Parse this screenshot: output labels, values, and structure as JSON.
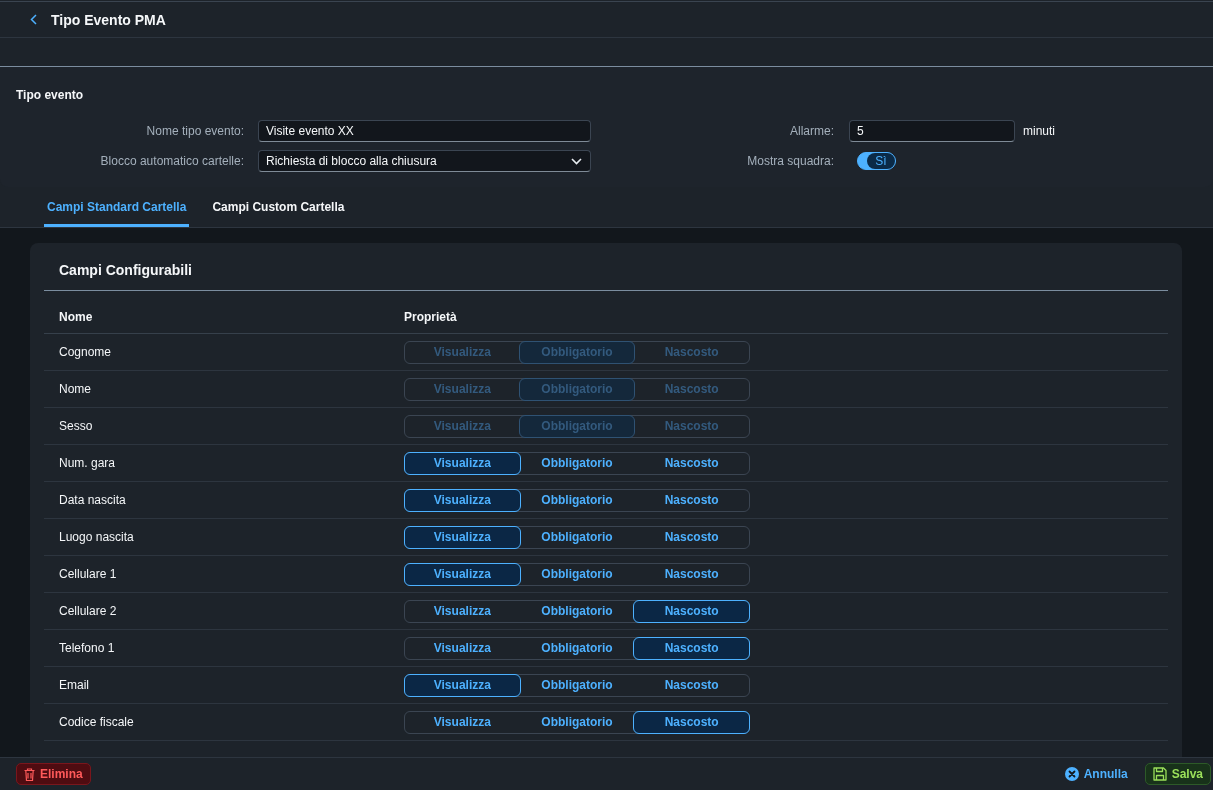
{
  "header": {
    "title": "Tipo Evento PMA"
  },
  "form": {
    "title": "Tipo evento",
    "columns": [
      [
        {
          "kind": "text",
          "label": "Nome tipo evento:",
          "value": "Visite evento XX"
        },
        {
          "kind": "select",
          "label": "Blocco automatico cartelle:",
          "value": "Richiesta di blocco alla chiusura"
        }
      ],
      [
        {
          "kind": "text",
          "label": "Allarme:",
          "value": "5",
          "unit": "minuti"
        },
        {
          "kind": "toggle",
          "label": "Mostra squadra:",
          "value": "Sì",
          "on": true
        }
      ]
    ]
  },
  "tabs": [
    {
      "label": "Campi Standard Cartella",
      "selected": true
    },
    {
      "label": "Campi Custom Cartella",
      "selected": false
    }
  ],
  "table": {
    "title": "Campi Configurabili",
    "columns": [
      "Nome",
      "Proprietà"
    ],
    "rows": [
      {
        "name": "Cognome",
        "disabled": true,
        "options": [
          {
            "label": "Visualizza",
            "selected": false
          },
          {
            "label": "Obbligatorio",
            "selected": true
          },
          {
            "label": "Nascosto",
            "selected": false
          }
        ]
      },
      {
        "name": "Nome",
        "disabled": true,
        "options": [
          {
            "label": "Visualizza",
            "selected": false
          },
          {
            "label": "Obbligatorio",
            "selected": true
          },
          {
            "label": "Nascosto",
            "selected": false
          }
        ]
      },
      {
        "name": "Sesso",
        "disabled": true,
        "options": [
          {
            "label": "Visualizza",
            "selected": false
          },
          {
            "label": "Obbligatorio",
            "selected": true
          },
          {
            "label": "Nascosto",
            "selected": false
          }
        ]
      },
      {
        "name": "Num. gara",
        "disabled": false,
        "options": [
          {
            "label": "Visualizza",
            "selected": true
          },
          {
            "label": "Obbligatorio",
            "selected": false
          },
          {
            "label": "Nascosto",
            "selected": false
          }
        ]
      },
      {
        "name": "Data nascita",
        "disabled": false,
        "options": [
          {
            "label": "Visualizza",
            "selected": true
          },
          {
            "label": "Obbligatorio",
            "selected": false
          },
          {
            "label": "Nascosto",
            "selected": false
          }
        ]
      },
      {
        "name": "Luogo nascita",
        "disabled": false,
        "options": [
          {
            "label": "Visualizza",
            "selected": true
          },
          {
            "label": "Obbligatorio",
            "selected": false
          },
          {
            "label": "Nascosto",
            "selected": false
          }
        ]
      },
      {
        "name": "Cellulare 1",
        "disabled": false,
        "options": [
          {
            "label": "Visualizza",
            "selected": true
          },
          {
            "label": "Obbligatorio",
            "selected": false
          },
          {
            "label": "Nascosto",
            "selected": false
          }
        ]
      },
      {
        "name": "Cellulare 2",
        "disabled": false,
        "options": [
          {
            "label": "Visualizza",
            "selected": false
          },
          {
            "label": "Obbligatorio",
            "selected": false
          },
          {
            "label": "Nascosto",
            "selected": true
          }
        ]
      },
      {
        "name": "Telefono 1",
        "disabled": false,
        "options": [
          {
            "label": "Visualizza",
            "selected": false
          },
          {
            "label": "Obbligatorio",
            "selected": false
          },
          {
            "label": "Nascosto",
            "selected": true
          }
        ]
      },
      {
        "name": "Email",
        "disabled": false,
        "options": [
          {
            "label": "Visualizza",
            "selected": true
          },
          {
            "label": "Obbligatorio",
            "selected": false
          },
          {
            "label": "Nascosto",
            "selected": false
          }
        ]
      },
      {
        "name": "Codice fiscale",
        "disabled": false,
        "options": [
          {
            "label": "Visualizza",
            "selected": false
          },
          {
            "label": "Obbligatorio",
            "selected": false
          },
          {
            "label": "Nascosto",
            "selected": true
          }
        ]
      }
    ]
  },
  "footer": {
    "left": [
      {
        "kind": "delete",
        "label": "Elimina"
      }
    ],
    "right": [
      {
        "kind": "cancel",
        "label": "Annulla"
      },
      {
        "kind": "save",
        "label": "Salva"
      }
    ]
  }
}
